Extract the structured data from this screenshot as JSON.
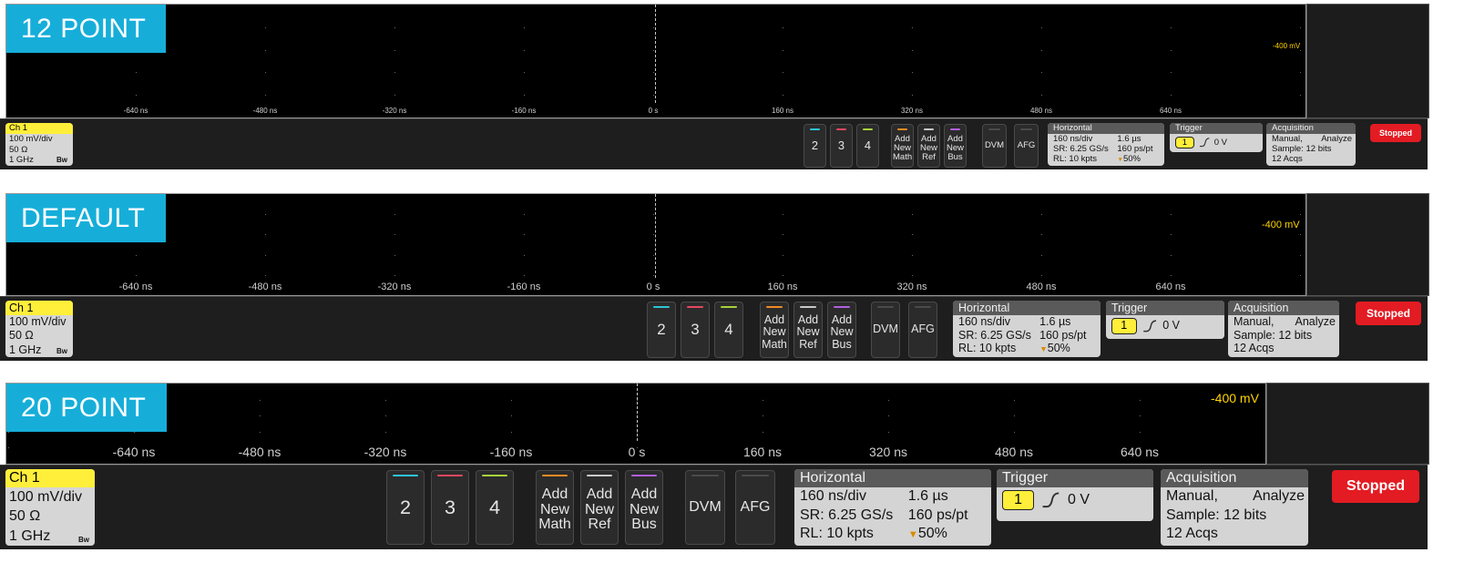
{
  "panels": [
    {
      "label": "12 POINT",
      "time_ticks": [
        "-640 ns",
        "-480 ns",
        "-320 ns",
        "-160 ns",
        "0 s",
        "160 ns",
        "320 ns",
        "480 ns",
        "640 ns"
      ],
      "voltage": "-400 mV",
      "channel": {
        "name": "Ch 1",
        "scale": "100 mV/div",
        "impedance": "50 Ω",
        "bandwidth": "1 GHz",
        "bw_icon": "bw-limit-icon"
      },
      "channel_buttons": [
        {
          "label": "2",
          "color": "#2ec4d6"
        },
        {
          "label": "3",
          "color": "#e8475f"
        },
        {
          "label": "4",
          "color": "#a8d23a"
        }
      ],
      "add_buttons": [
        {
          "label": "Add New Math",
          "color": "#f08a24"
        },
        {
          "label": "Add New Ref",
          "color": "#c9c9c9"
        },
        {
          "label": "Add New Bus",
          "color": "#b25fe0"
        }
      ],
      "tool_buttons": [
        {
          "label": "DVM"
        },
        {
          "label": "AFG"
        }
      ],
      "horizontal": {
        "title": "Horizontal",
        "scale": "160 ns/div",
        "record_time": "1.6 µs",
        "sample_rate": "SR: 6.25 GS/s",
        "resolution": "160 ps/pt",
        "record_length": "RL: 10 kpts",
        "position": "50%"
      },
      "trigger": {
        "title": "Trigger",
        "source": "1",
        "slope_icon": "rising-edge-icon",
        "level": "0 V"
      },
      "acquisition": {
        "title": "Acquisition",
        "mode": "Manual,",
        "analyze": "Analyze",
        "sample": "Sample: 12 bits",
        "acqs": "12 Acqs"
      },
      "status": "Stopped"
    },
    {
      "label": "DEFAULT",
      "time_ticks": [
        "-640 ns",
        "-480 ns",
        "-320 ns",
        "-160 ns",
        "0 s",
        "160 ns",
        "320 ns",
        "480 ns",
        "640 ns"
      ],
      "voltage": "-400 mV",
      "channel": {
        "name": "Ch 1",
        "scale": "100 mV/div",
        "impedance": "50 Ω",
        "bandwidth": "1 GHz",
        "bw_icon": "bw-limit-icon"
      },
      "channel_buttons": [
        {
          "label": "2",
          "color": "#2ec4d6"
        },
        {
          "label": "3",
          "color": "#e8475f"
        },
        {
          "label": "4",
          "color": "#a8d23a"
        }
      ],
      "add_buttons": [
        {
          "label": "Add New Math",
          "color": "#f08a24"
        },
        {
          "label": "Add New Ref",
          "color": "#c9c9c9"
        },
        {
          "label": "Add New Bus",
          "color": "#b25fe0"
        }
      ],
      "tool_buttons": [
        {
          "label": "DVM"
        },
        {
          "label": "AFG"
        }
      ],
      "horizontal": {
        "title": "Horizontal",
        "scale": "160 ns/div",
        "record_time": "1.6 µs",
        "sample_rate": "SR: 6.25 GS/s",
        "resolution": "160 ps/pt",
        "record_length": "RL: 10 kpts",
        "position": "50%"
      },
      "trigger": {
        "title": "Trigger",
        "source": "1",
        "slope_icon": "rising-edge-icon",
        "level": "0 V"
      },
      "acquisition": {
        "title": "Acquisition",
        "mode": "Manual,",
        "analyze": "Analyze",
        "sample": "Sample: 12 bits",
        "acqs": "12 Acqs"
      },
      "status": "Stopped"
    },
    {
      "label": "20 POINT",
      "time_ticks": [
        "-640 ns",
        "-480 ns",
        "-320 ns",
        "-160 ns",
        "0 s",
        "160 ns",
        "320 ns",
        "480 ns",
        "640 ns"
      ],
      "voltage": "-400 mV",
      "channel": {
        "name": "Ch 1",
        "scale": "100 mV/div",
        "impedance": "50 Ω",
        "bandwidth": "1 GHz",
        "bw_icon": "bw-limit-icon"
      },
      "channel_buttons": [
        {
          "label": "2",
          "color": "#2ec4d6"
        },
        {
          "label": "3",
          "color": "#e8475f"
        },
        {
          "label": "4",
          "color": "#a8d23a"
        }
      ],
      "add_buttons": [
        {
          "label": "Add New Math",
          "color": "#f08a24"
        },
        {
          "label": "Add New Ref",
          "color": "#c9c9c9"
        },
        {
          "label": "Add New Bus",
          "color": "#b25fe0"
        }
      ],
      "tool_buttons": [
        {
          "label": "DVM"
        },
        {
          "label": "AFG"
        }
      ],
      "horizontal": {
        "title": "Horizontal",
        "scale": "160 ns/div",
        "record_time": "1.6 µs",
        "sample_rate": "SR: 6.25 GS/s",
        "resolution": "160 ps/pt",
        "record_length": "RL: 10 kpts",
        "position": "50%"
      },
      "trigger": {
        "title": "Trigger",
        "source": "1",
        "slope_icon": "rising-edge-icon",
        "level": "0 V"
      },
      "acquisition": {
        "title": "Acquisition",
        "mode": "Manual,",
        "analyze": "Analyze",
        "sample": "Sample: 12 bits",
        "acqs": "12 Acqs"
      },
      "status": "Stopped"
    }
  ]
}
